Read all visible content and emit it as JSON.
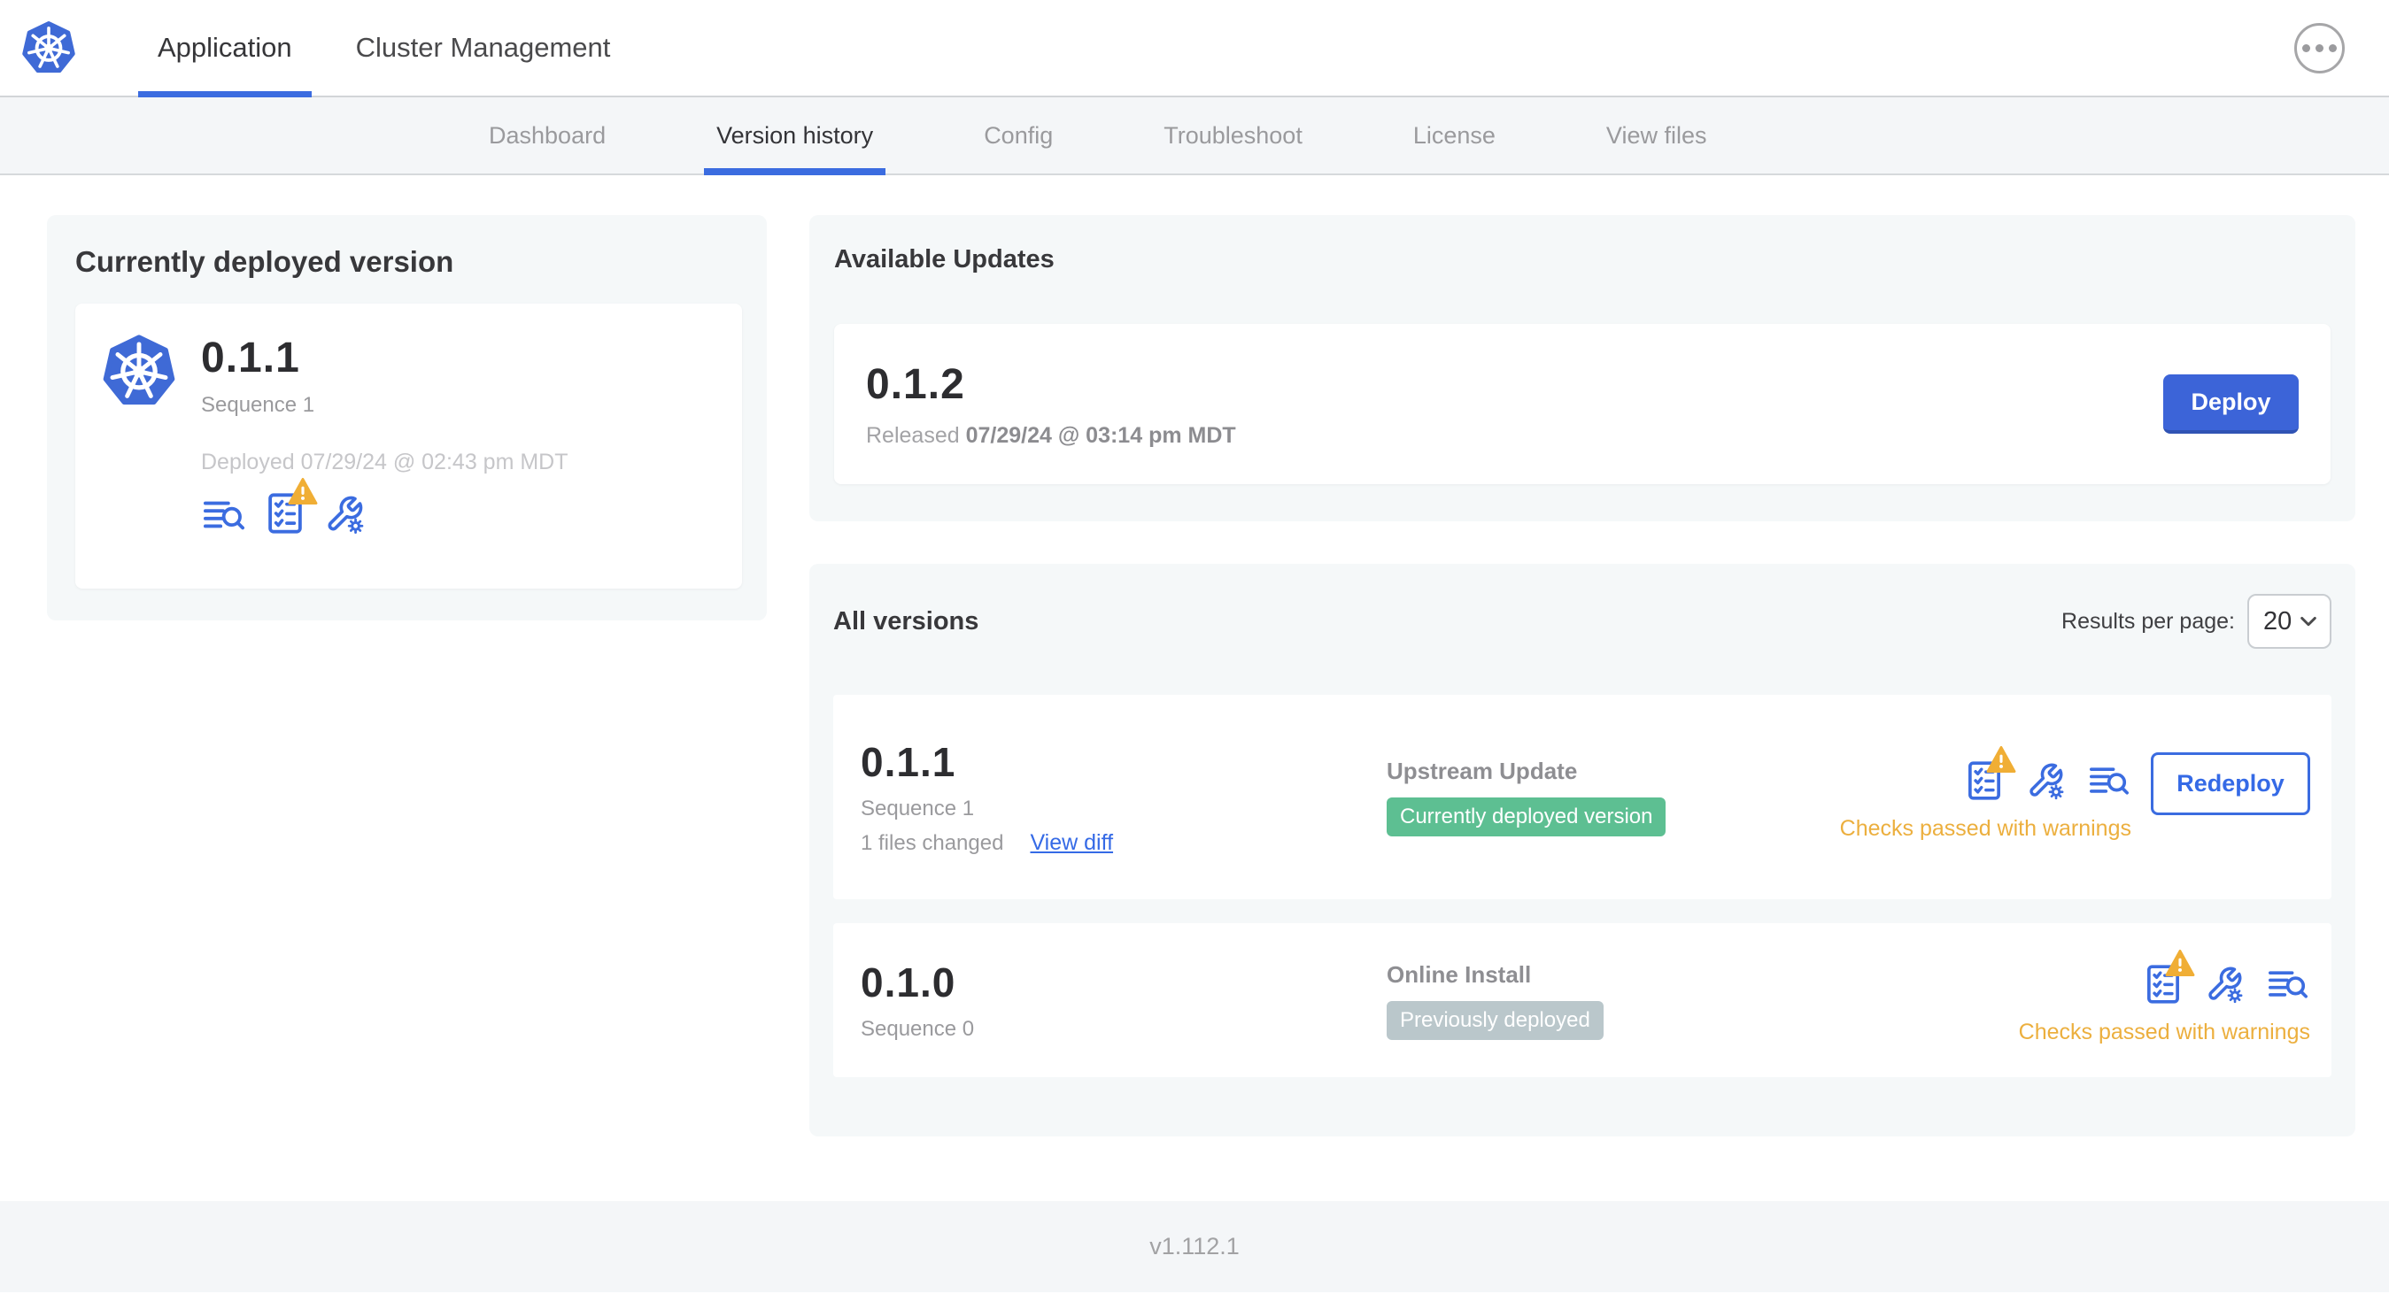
{
  "top_nav": {
    "tabs": [
      {
        "label": "Application",
        "active": true
      },
      {
        "label": "Cluster Management",
        "active": false
      }
    ]
  },
  "sub_nav": {
    "tabs": [
      {
        "label": "Dashboard",
        "active": false
      },
      {
        "label": "Version history",
        "active": true
      },
      {
        "label": "Config",
        "active": false
      },
      {
        "label": "Troubleshoot",
        "active": false
      },
      {
        "label": "License",
        "active": false
      },
      {
        "label": "View files",
        "active": false
      }
    ]
  },
  "current": {
    "title": "Currently deployed version",
    "version": "0.1.1",
    "sequence": "Sequence 1",
    "deployed": "Deployed 07/29/24 @ 02:43 pm MDT"
  },
  "updates": {
    "title": "Available Updates",
    "version": "0.1.2",
    "released_prefix": "Released",
    "released_date": "07/29/24 @ 03:14 pm MDT",
    "deploy_label": "Deploy"
  },
  "versions": {
    "title": "All versions",
    "results_label": "Results per page:",
    "results_value": "20",
    "rows": [
      {
        "version": "0.1.1",
        "sequence": "Sequence 1",
        "files_changed": "1 files changed",
        "view_diff": "View diff",
        "source": "Upstream Update",
        "badge": "Currently deployed version",
        "badge_color": "green",
        "status": "Checks passed with warnings",
        "action": "Redeploy"
      },
      {
        "version": "0.1.0",
        "sequence": "Sequence 0",
        "source": "Online Install",
        "badge": "Previously deployed",
        "badge_color": "gray",
        "status": "Checks passed with warnings"
      }
    ]
  },
  "footer": {
    "version": "v1.112.1"
  },
  "icons": {
    "app_logo": "kubernetes-logo",
    "overflow": "ellipsis-icon",
    "row_actions": [
      "preflight-checks-icon",
      "config-icon",
      "deploy-logs-icon"
    ],
    "warning_overlay": "warning-triangle-icon",
    "select_chevron": "chevron-down-icon"
  },
  "colors": {
    "accent_blue": "#3b6ce0",
    "deploy_button": "#3c64d8",
    "badge_green": "#5dbf92",
    "badge_gray": "#bac7cb",
    "warning_orange": "#ecaf3e",
    "card_background": "#f5f8f9"
  }
}
